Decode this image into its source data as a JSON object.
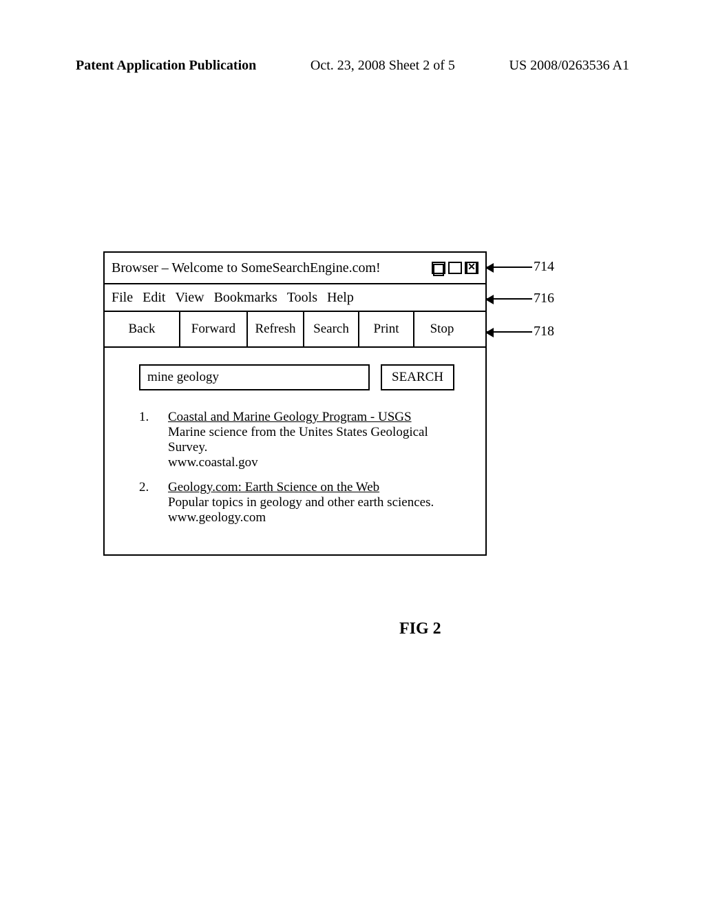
{
  "header": {
    "left": "Patent Application Publication",
    "center": "Oct. 23, 2008  Sheet 2 of 5",
    "right": "US 2008/0263536 A1"
  },
  "browser": {
    "title": "Browser – Welcome to SomeSearchEngine.com!",
    "menu": {
      "file": "File",
      "edit": "Edit",
      "view": "View",
      "bookmarks": "Bookmarks",
      "tools": "Tools",
      "help": "Help"
    },
    "toolbar": {
      "back": "Back",
      "forward": "Forward",
      "refresh": "Refresh",
      "search": "Search",
      "print": "Print",
      "stop": "Stop"
    },
    "search": {
      "value": "mine geology",
      "button": "SEARCH"
    },
    "results": [
      {
        "num": "1.",
        "title": "Coastal and Marine Geology Program - USGS",
        "desc": "Marine science from the Unites States Geological Survey.",
        "url": "www.coastal.gov"
      },
      {
        "num": "2.",
        "title": "Geology.com:  Earth Science on the Web",
        "desc": "Popular topics in geology and other earth sciences.",
        "url": "www.geology.com"
      }
    ]
  },
  "callouts": {
    "c714": "714",
    "c716": "716",
    "c718": "718"
  },
  "figure": "FIG 2"
}
